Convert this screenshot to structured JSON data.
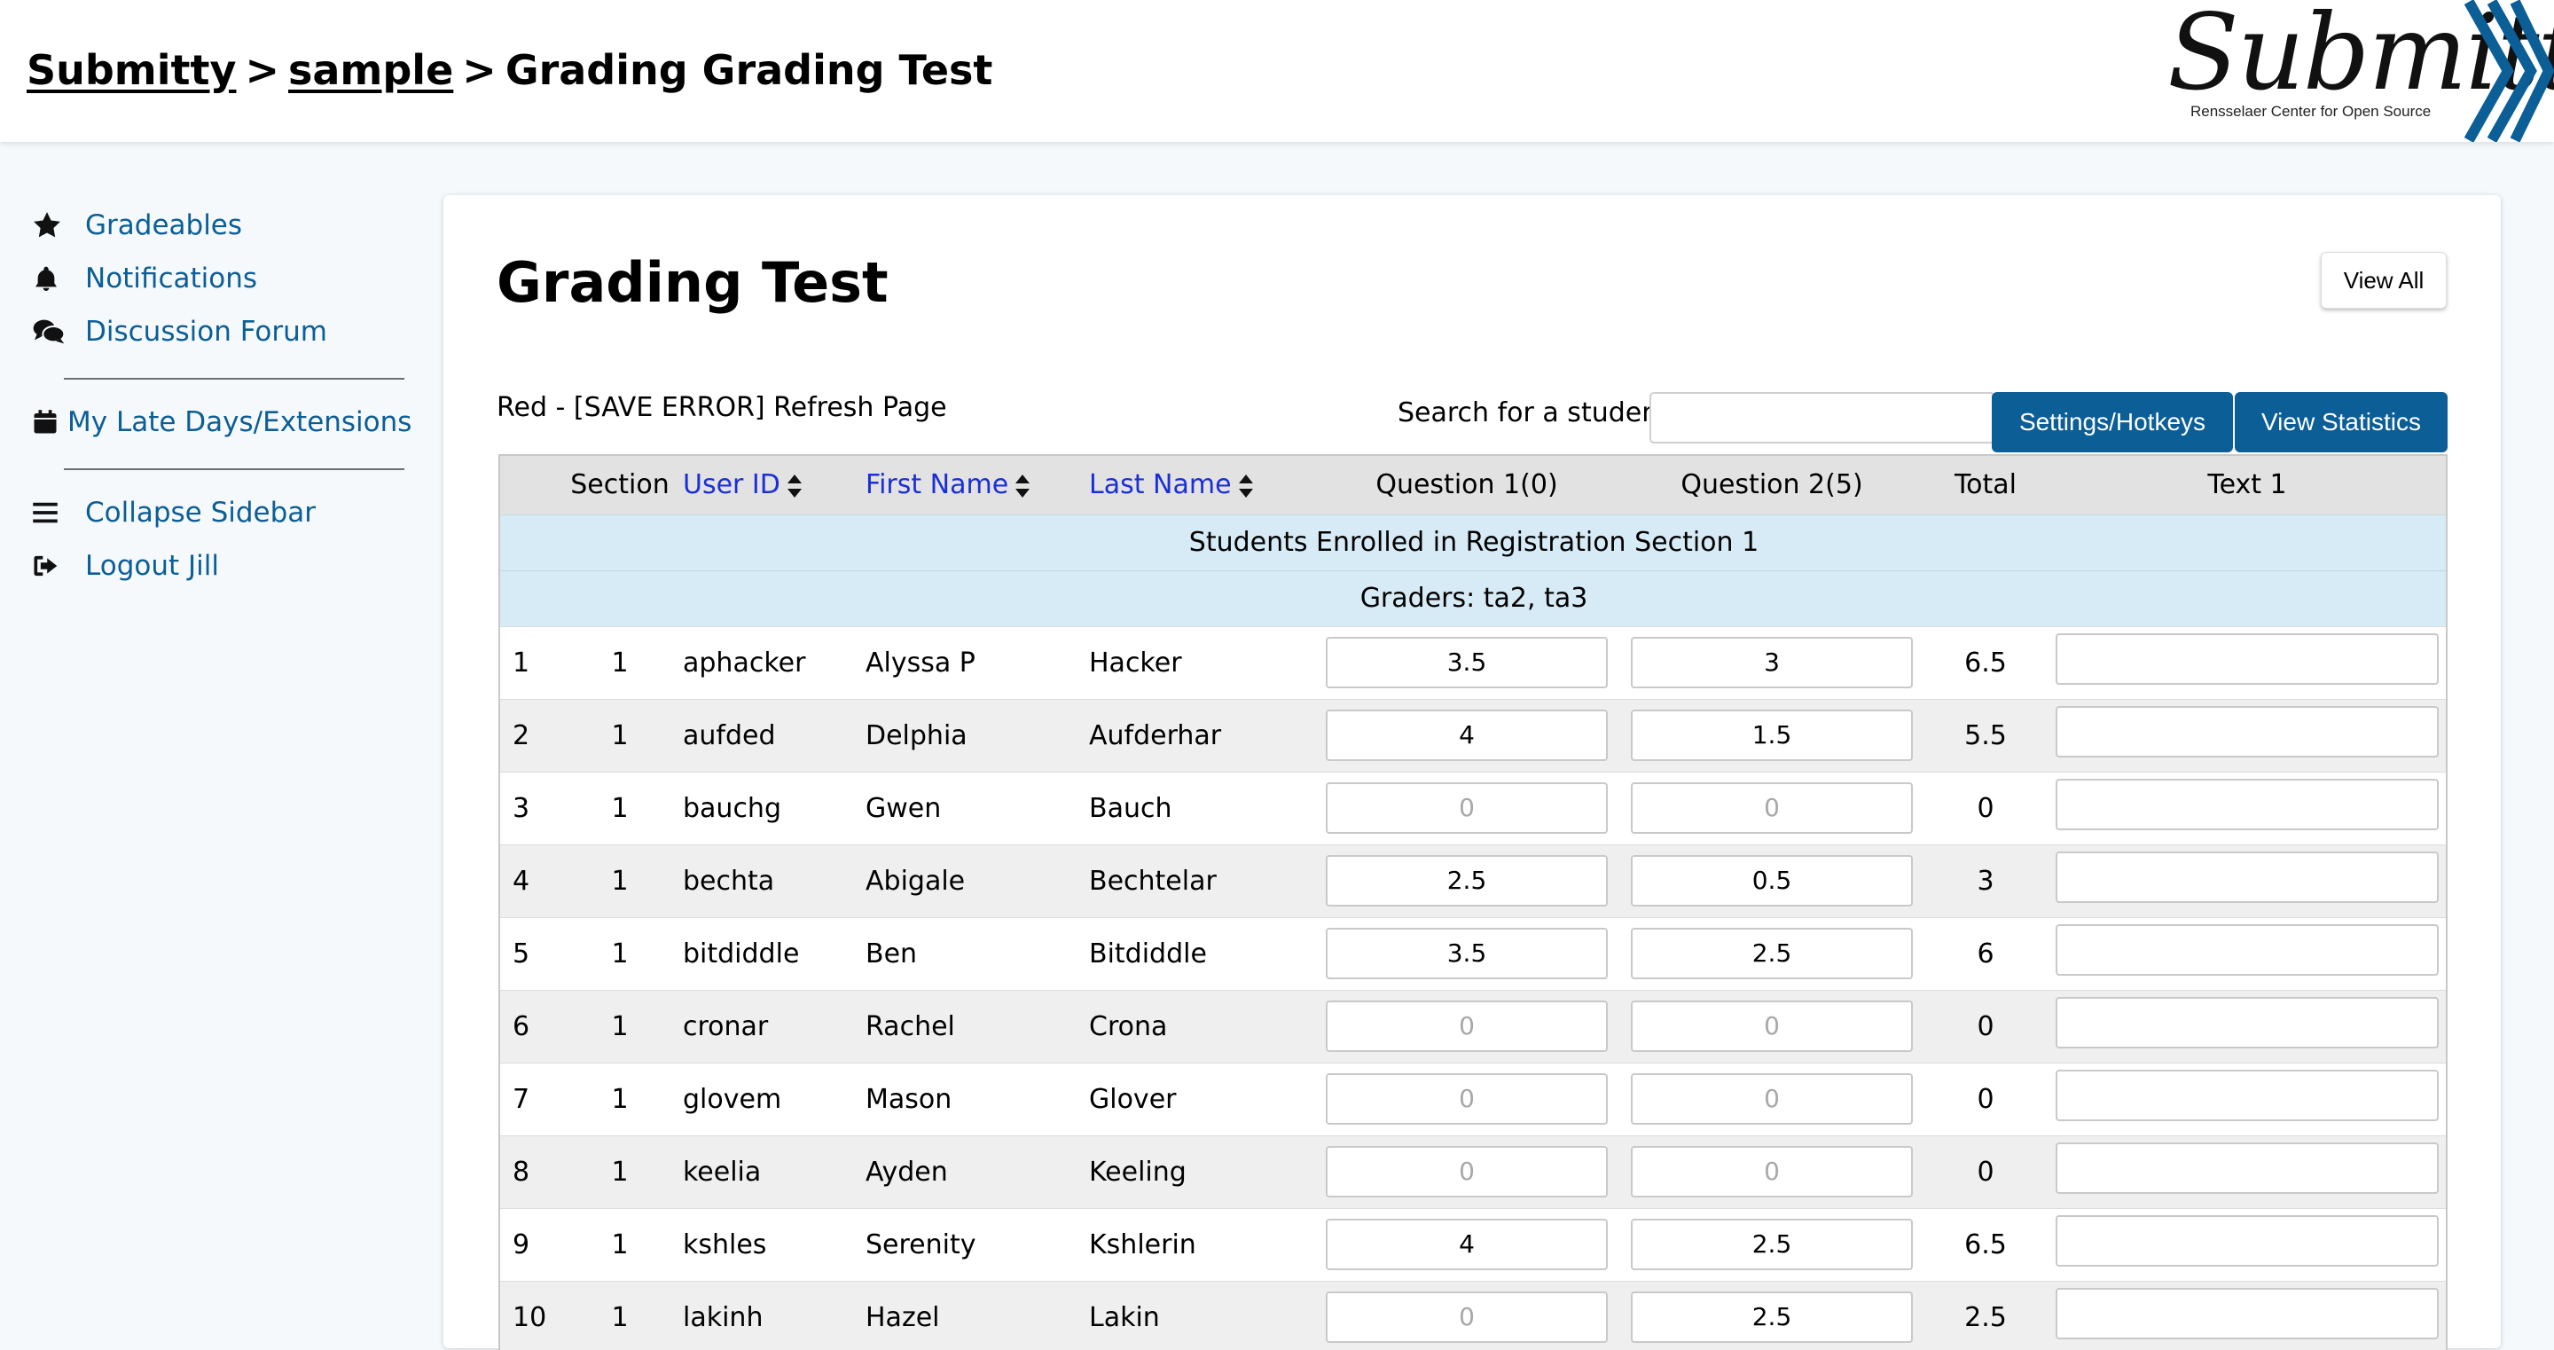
{
  "header": {
    "crumbs": [
      {
        "label": "Submitty"
      },
      {
        "label": "sample"
      }
    ],
    "separator": ">",
    "current": "Grading Grading Test",
    "logo_word": "Submitty",
    "logo_sub": "Rensselaer Center for Open Source"
  },
  "sidebar": {
    "items": [
      {
        "label": "Gradeables",
        "icon": "star-icon"
      },
      {
        "label": "Notifications",
        "icon": "bell-icon"
      },
      {
        "label": "Discussion Forum",
        "icon": "comments-icon"
      },
      {
        "label": "My Late Days/Extensions",
        "icon": "calendar-icon"
      },
      {
        "label": "Collapse Sidebar",
        "icon": "bars-icon"
      },
      {
        "label": "Logout Jill",
        "icon": "sign-out-icon"
      }
    ]
  },
  "main": {
    "title": "Grading Test",
    "view_all_label": "View All",
    "legend": "Red - [SAVE ERROR] Refresh Page",
    "search_label": "Search for a student:",
    "search_value": "",
    "settings_label": "Settings/Hotkeys",
    "stats_label": "View Statistics"
  },
  "table": {
    "headers": [
      "",
      "Section",
      "User ID",
      "First Name",
      "Last Name",
      "Question 1(0)",
      "Question 2(5)",
      "Total",
      "Text 1"
    ],
    "section_title": "Students Enrolled in Registration Section 1",
    "graders": "Graders: ta2, ta3",
    "rows": [
      {
        "num": "1",
        "section": "1",
        "user_id": "aphacker",
        "first": "Alyssa P",
        "last": "Hacker",
        "q1": "3.5",
        "q2": "3",
        "total": "6.5"
      },
      {
        "num": "2",
        "section": "1",
        "user_id": "aufded",
        "first": "Delphia",
        "last": "Aufderhar",
        "q1": "4",
        "q2": "1.5",
        "total": "5.5"
      },
      {
        "num": "3",
        "section": "1",
        "user_id": "bauchg",
        "first": "Gwen",
        "last": "Bauch",
        "q1": "0",
        "q2": "0",
        "total": "0"
      },
      {
        "num": "4",
        "section": "1",
        "user_id": "bechta",
        "first": "Abigale",
        "last": "Bechtelar",
        "q1": "2.5",
        "q2": "0.5",
        "total": "3"
      },
      {
        "num": "5",
        "section": "1",
        "user_id": "bitdiddle",
        "first": "Ben",
        "last": "Bitdiddle",
        "q1": "3.5",
        "q2": "2.5",
        "total": "6"
      },
      {
        "num": "6",
        "section": "1",
        "user_id": "cronar",
        "first": "Rachel",
        "last": "Crona",
        "q1": "0",
        "q2": "0",
        "total": "0"
      },
      {
        "num": "7",
        "section": "1",
        "user_id": "glovem",
        "first": "Mason",
        "last": "Glover",
        "q1": "0",
        "q2": "0",
        "total": "0"
      },
      {
        "num": "8",
        "section": "1",
        "user_id": "keelia",
        "first": "Ayden",
        "last": "Keeling",
        "q1": "0",
        "q2": "0",
        "total": "0"
      },
      {
        "num": "9",
        "section": "1",
        "user_id": "kshles",
        "first": "Serenity",
        "last": "Kshlerin",
        "q1": "4",
        "q2": "2.5",
        "total": "6.5"
      },
      {
        "num": "10",
        "section": "1",
        "user_id": "lakinh",
        "first": "Hazel",
        "last": "Lakin",
        "q1": "0",
        "q2": "2.5",
        "total": "2.5"
      }
    ]
  },
  "colors": {
    "brand_blue": "#0b5e96",
    "link_blue": "#1c2fd6",
    "section_bg": "#d7ebf6"
  }
}
